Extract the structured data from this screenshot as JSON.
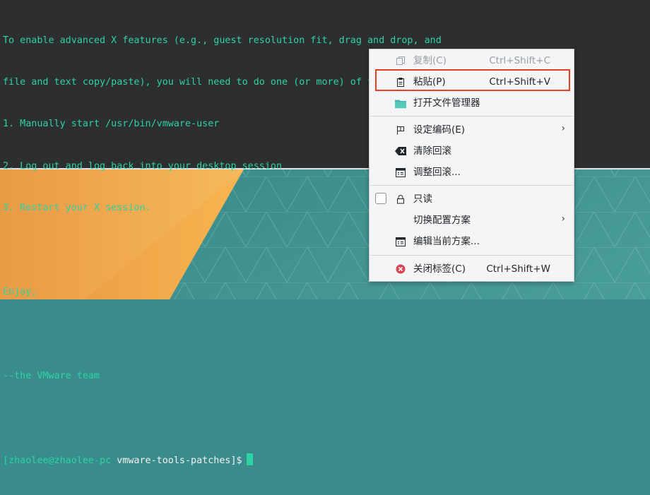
{
  "terminal": {
    "lines": [
      "To enable advanced X features (e.g., guest resolution fit, drag and drop, and",
      "file and text copy/paste), you will need to do one (or more) of the following:",
      "1. Manually start /usr/bin/vmware-user",
      "2. Log out and log back into your desktop session",
      "3. Restart your X session.",
      "",
      "Enjoy,",
      "",
      "--the VMware team",
      ""
    ],
    "prompt_user": "[zhaolee@zhaolee-pc",
    "prompt_dir": "vmware-tools-patches]$"
  },
  "menu": {
    "copy": {
      "label": "复制(C)",
      "shortcut": "Ctrl+Shift+C",
      "icon": "copy-icon"
    },
    "paste": {
      "label": "粘贴(P)",
      "shortcut": "Ctrl+Shift+V",
      "icon": "clipboard-icon"
    },
    "open_fm": {
      "label": "打开文件管理器",
      "icon": "folder-icon"
    },
    "encoding": {
      "label": "设定编码(E)",
      "icon": "flag-icon"
    },
    "clear_scroll": {
      "label": "清除回滚",
      "icon": "backspace-icon"
    },
    "adjust_scroll": {
      "label": "调整回滚...",
      "icon": "window-icon"
    },
    "readonly": {
      "label": "只读",
      "icon": "lock-icon"
    },
    "switch_profile": {
      "label": "切换配置方案"
    },
    "edit_profile": {
      "label": "编辑当前方案...",
      "icon": "window-icon"
    },
    "close_tab": {
      "label": "关闭标签(C)",
      "shortcut": "Ctrl+Shift+W",
      "icon": "close-circle-icon"
    }
  },
  "colors": {
    "terminal_bg": "#2d2e2f",
    "terminal_text": "#2fd3a3",
    "highlight_border": "#e2401f",
    "wallpaper_orange": "#f1a542",
    "wallpaper_teal": "#3d8f8e"
  }
}
